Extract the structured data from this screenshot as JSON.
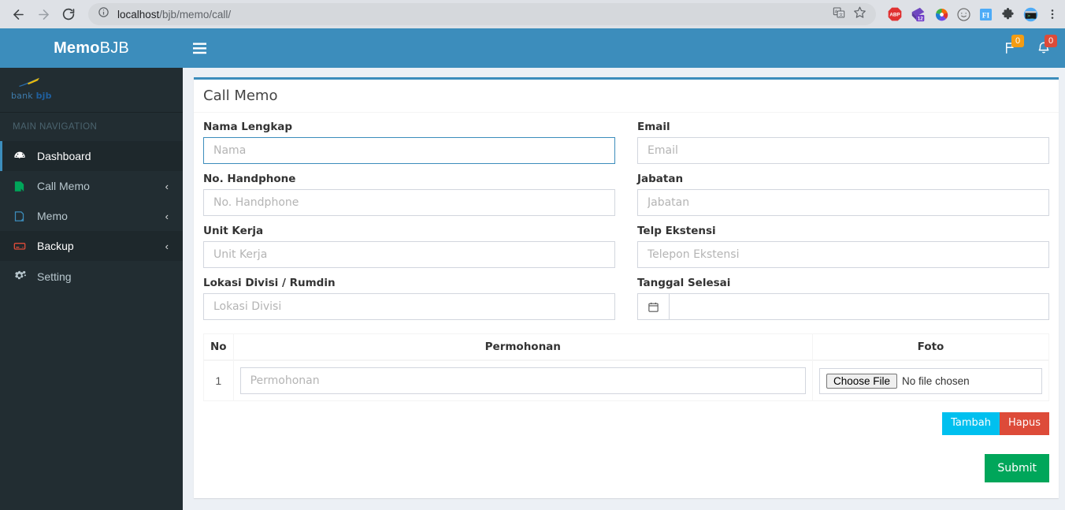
{
  "browser": {
    "url_prefix": "localhost",
    "url_rest": "/bjb/memo/call/",
    "back_icon": "back-arrow-icon",
    "forward_icon": "forward-arrow-icon",
    "reload_icon": "reload-icon",
    "info_icon": "site-info-icon",
    "translate_icon": "translate-icon",
    "bookmark_icon": "star-icon",
    "menu_icon": "chrome-menu-icon",
    "extensions": [
      {
        "name": "adblock-plus-extension-icon",
        "label": "ABP"
      },
      {
        "name": "tab-manager-extension-icon",
        "label": "12"
      },
      {
        "name": "color-picker-extension-icon",
        "label": ""
      },
      {
        "name": "emoji-extension-icon",
        "label": ""
      },
      {
        "name": "font-inspector-extension-icon",
        "label": "FI"
      },
      {
        "name": "puzzle-extensions-icon",
        "label": ""
      },
      {
        "name": "terminal-extension-icon",
        "label": ""
      }
    ]
  },
  "sidebar": {
    "brand_bold": "Memo",
    "brand_light": "BJB",
    "logo_text_prefix": "bank ",
    "logo_text_bold": "bjb",
    "nav_header": "MAIN NAVIGATION",
    "items": [
      {
        "label": "Dashboard",
        "icon": "dashboard-icon",
        "chevron": "",
        "state": "active"
      },
      {
        "label": "Call Memo",
        "icon": "call-memo-icon",
        "chevron": "‹",
        "state": "normal"
      },
      {
        "label": "Memo",
        "icon": "memo-icon",
        "chevron": "‹",
        "state": "normal"
      },
      {
        "label": "Backup",
        "icon": "backup-icon",
        "chevron": "‹",
        "state": "hl"
      },
      {
        "label": "Setting",
        "icon": "setting-gears-icon",
        "chevron": "",
        "state": "normal"
      }
    ]
  },
  "navbar": {
    "toggle_icon": "hamburger-menu-icon",
    "flag_icon": "flag-icon",
    "flag_count": "0",
    "bell_icon": "bell-icon",
    "bell_count": "0"
  },
  "page": {
    "title": "Call Memo",
    "colors": {
      "primary": "#3c8dbc",
      "sidebar": "#222d32",
      "info": "#00c0ef",
      "danger": "#dd4b39",
      "success": "#00a65a",
      "warning": "#f39c12",
      "body": "#ecf0f5"
    },
    "fields_left": [
      {
        "label": "Nama Lengkap",
        "placeholder": "Nama",
        "value": "",
        "name": "nama-lengkap",
        "focused": true
      },
      {
        "label": "No. Handphone",
        "placeholder": "No. Handphone",
        "value": "",
        "name": "no-handphone",
        "focused": false
      },
      {
        "label": "Unit Kerja",
        "placeholder": "Unit Kerja",
        "value": "",
        "name": "unit-kerja",
        "focused": false
      },
      {
        "label": "Lokasi Divisi / Rumdin",
        "placeholder": "Lokasi Divisi",
        "value": "",
        "name": "lokasi-divisi",
        "focused": false
      }
    ],
    "fields_right": [
      {
        "label": "Email",
        "placeholder": "Email",
        "value": "",
        "name": "email",
        "focused": false
      },
      {
        "label": "Jabatan",
        "placeholder": "Jabatan",
        "value": "",
        "name": "jabatan",
        "focused": false
      },
      {
        "label": "Telp Ekstensi",
        "placeholder": "Telepon Ekstensi",
        "value": "",
        "name": "telp-ekstensi",
        "focused": false
      }
    ],
    "date_field": {
      "label": "Tanggal Selesai",
      "placeholder": "",
      "value": "",
      "icon": "calendar-icon"
    },
    "table": {
      "headers": [
        "No",
        "Permohonan",
        "Foto"
      ],
      "rows": [
        {
          "no": "1",
          "permohonan_placeholder": "Permohonan",
          "permohonan_value": "",
          "file_button": "Choose File",
          "file_status": "No file chosen"
        }
      ]
    },
    "buttons": {
      "tambah": "Tambah",
      "hapus": "Hapus",
      "submit": "Submit"
    }
  }
}
